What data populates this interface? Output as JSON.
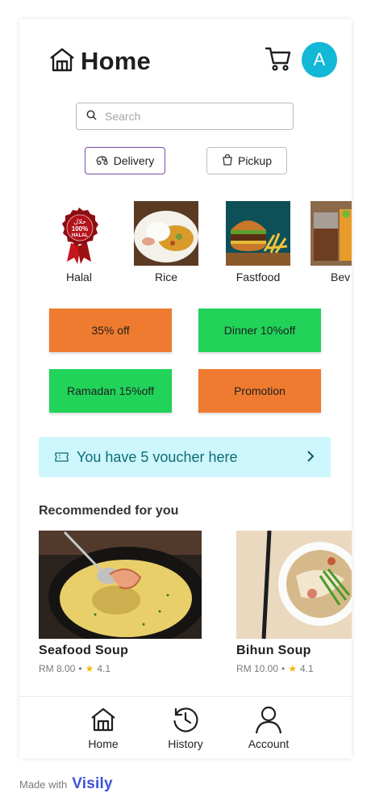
{
  "header": {
    "title": "Home",
    "avatar_initial": "A"
  },
  "search": {
    "placeholder": "Search"
  },
  "modes": [
    {
      "label": "Delivery"
    },
    {
      "label": "Pickup"
    }
  ],
  "categories": [
    {
      "label": "Halal",
      "badge_top": "حلال",
      "badge_mid": "100%",
      "badge_bottom": "HALAL"
    },
    {
      "label": "Rice"
    },
    {
      "label": "Fastfood"
    },
    {
      "label": "Bev"
    }
  ],
  "promos": [
    {
      "label": "35% off",
      "color": "#ee7b2f"
    },
    {
      "label": "Dinner 10%off",
      "color": "#22d35a"
    },
    {
      "label": "Ramadan 15%off",
      "color": "#22d35a"
    },
    {
      "label": "Promotion",
      "color": "#ee7b2f"
    }
  ],
  "voucher": {
    "text": "You have 5 voucher here"
  },
  "recommended": {
    "heading": "Recommended for you",
    "items": [
      {
        "name": "Seafood  Soup",
        "price": "RM 8.00",
        "rating": "4.1"
      },
      {
        "name": "Bihun  Soup",
        "price": "RM 10.00",
        "rating": "4.1"
      }
    ]
  },
  "bottom_nav": [
    {
      "label": "Home"
    },
    {
      "label": "History"
    },
    {
      "label": "Account"
    }
  ],
  "footer": {
    "made_with": "Made with",
    "brand": "Visily"
  }
}
